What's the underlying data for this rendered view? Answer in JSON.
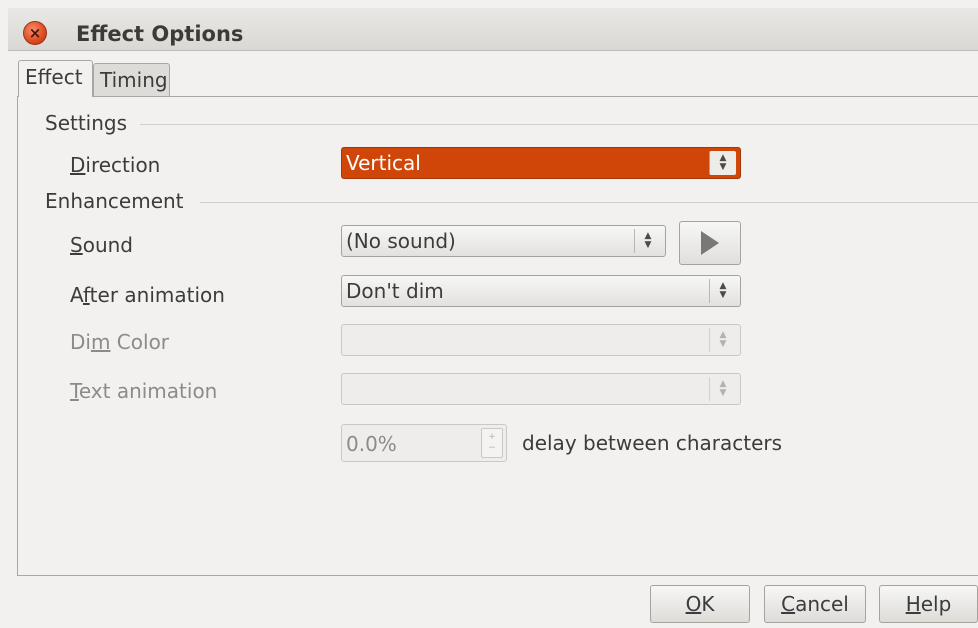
{
  "window": {
    "title": "Effect Options"
  },
  "tabs": [
    {
      "label": "Effect",
      "active": true
    },
    {
      "label": "Timing",
      "active": false
    }
  ],
  "settings": {
    "heading": "Settings",
    "direction": {
      "label_pre": "",
      "label_key": "D",
      "label_post": "irection",
      "value": "Vertical"
    }
  },
  "enhancement": {
    "heading": "Enhancement",
    "sound": {
      "label_pre": "",
      "label_key": "S",
      "label_post": "ound",
      "value": "(No sound)",
      "play_icon": "play-icon"
    },
    "after_animation": {
      "label_pre": "A",
      "label_key": "f",
      "label_post": "ter animation",
      "value": "Don't dim"
    },
    "dim_color": {
      "label_pre": "Di",
      "label_key": "m",
      "label_post": " Color",
      "value": ""
    },
    "text_animation": {
      "label_pre": "",
      "label_key": "T",
      "label_post": "ext animation",
      "value": ""
    },
    "delay": {
      "value": "0.0%",
      "suffix": "delay between characters"
    }
  },
  "buttons": {
    "ok": {
      "pre": "",
      "key": "O",
      "post": "K"
    },
    "cancel": {
      "pre": "",
      "key": "C",
      "post": "ancel"
    },
    "help": {
      "pre": "",
      "key": "H",
      "post": "elp"
    }
  },
  "colors": {
    "selection": "#d04609",
    "close_button": "#dd4a21"
  }
}
